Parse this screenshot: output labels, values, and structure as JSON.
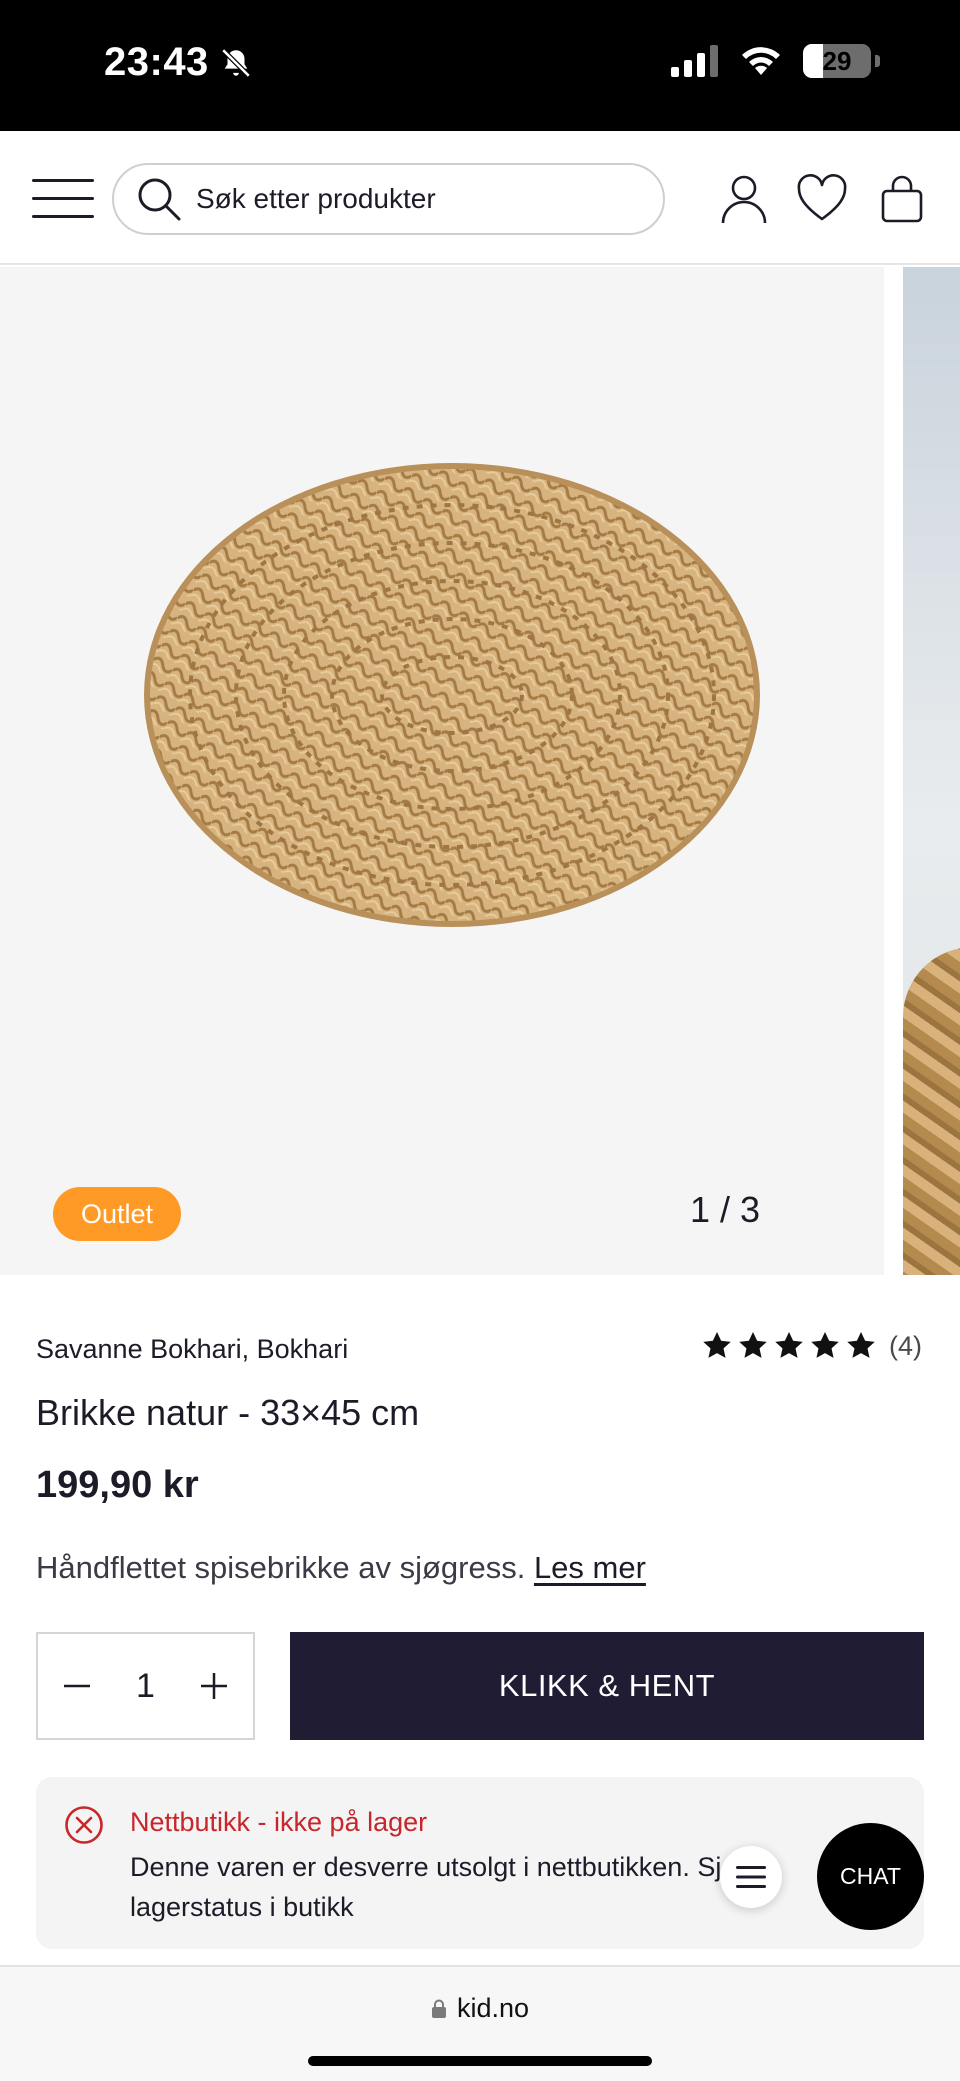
{
  "status_bar": {
    "time": "23:43",
    "battery": "29",
    "battery_fraction": 0.29
  },
  "header": {
    "search_placeholder": "Søk etter produkter"
  },
  "gallery": {
    "badge": "Outlet",
    "counter": "1 / 3"
  },
  "product": {
    "brand": "Savanne Bokhari, Bokhari",
    "rating_stars": 5,
    "rating_count": "(4)",
    "title": "Brikke natur - 33×45 cm",
    "price": "199,90 kr",
    "description": "Håndflettet spisebrikke av sjøgress.",
    "read_more": "Les mer"
  },
  "purchase": {
    "quantity": "1",
    "cta_label": "KLIKK & HENT"
  },
  "stock_notice": {
    "title": "Nettbutikk - ikke på lager",
    "body": "Denne varen er desverre utsolgt i nettbutikken. Sjekk lagerstatus i butikk"
  },
  "chat": {
    "label": "CHAT"
  },
  "browser": {
    "url": "kid.no"
  },
  "colors": {
    "accent_dark": "#1f1c33",
    "outlet_orange": "#ff9a26",
    "error_red": "#c8262b"
  },
  "icons": [
    "bell-slash-icon",
    "signal-icon",
    "wifi-icon",
    "battery-icon",
    "menu-icon",
    "search-icon",
    "user-icon",
    "heart-icon",
    "bag-icon",
    "star-icon",
    "minus-icon",
    "plus-icon",
    "error-circle-icon",
    "lock-icon"
  ]
}
